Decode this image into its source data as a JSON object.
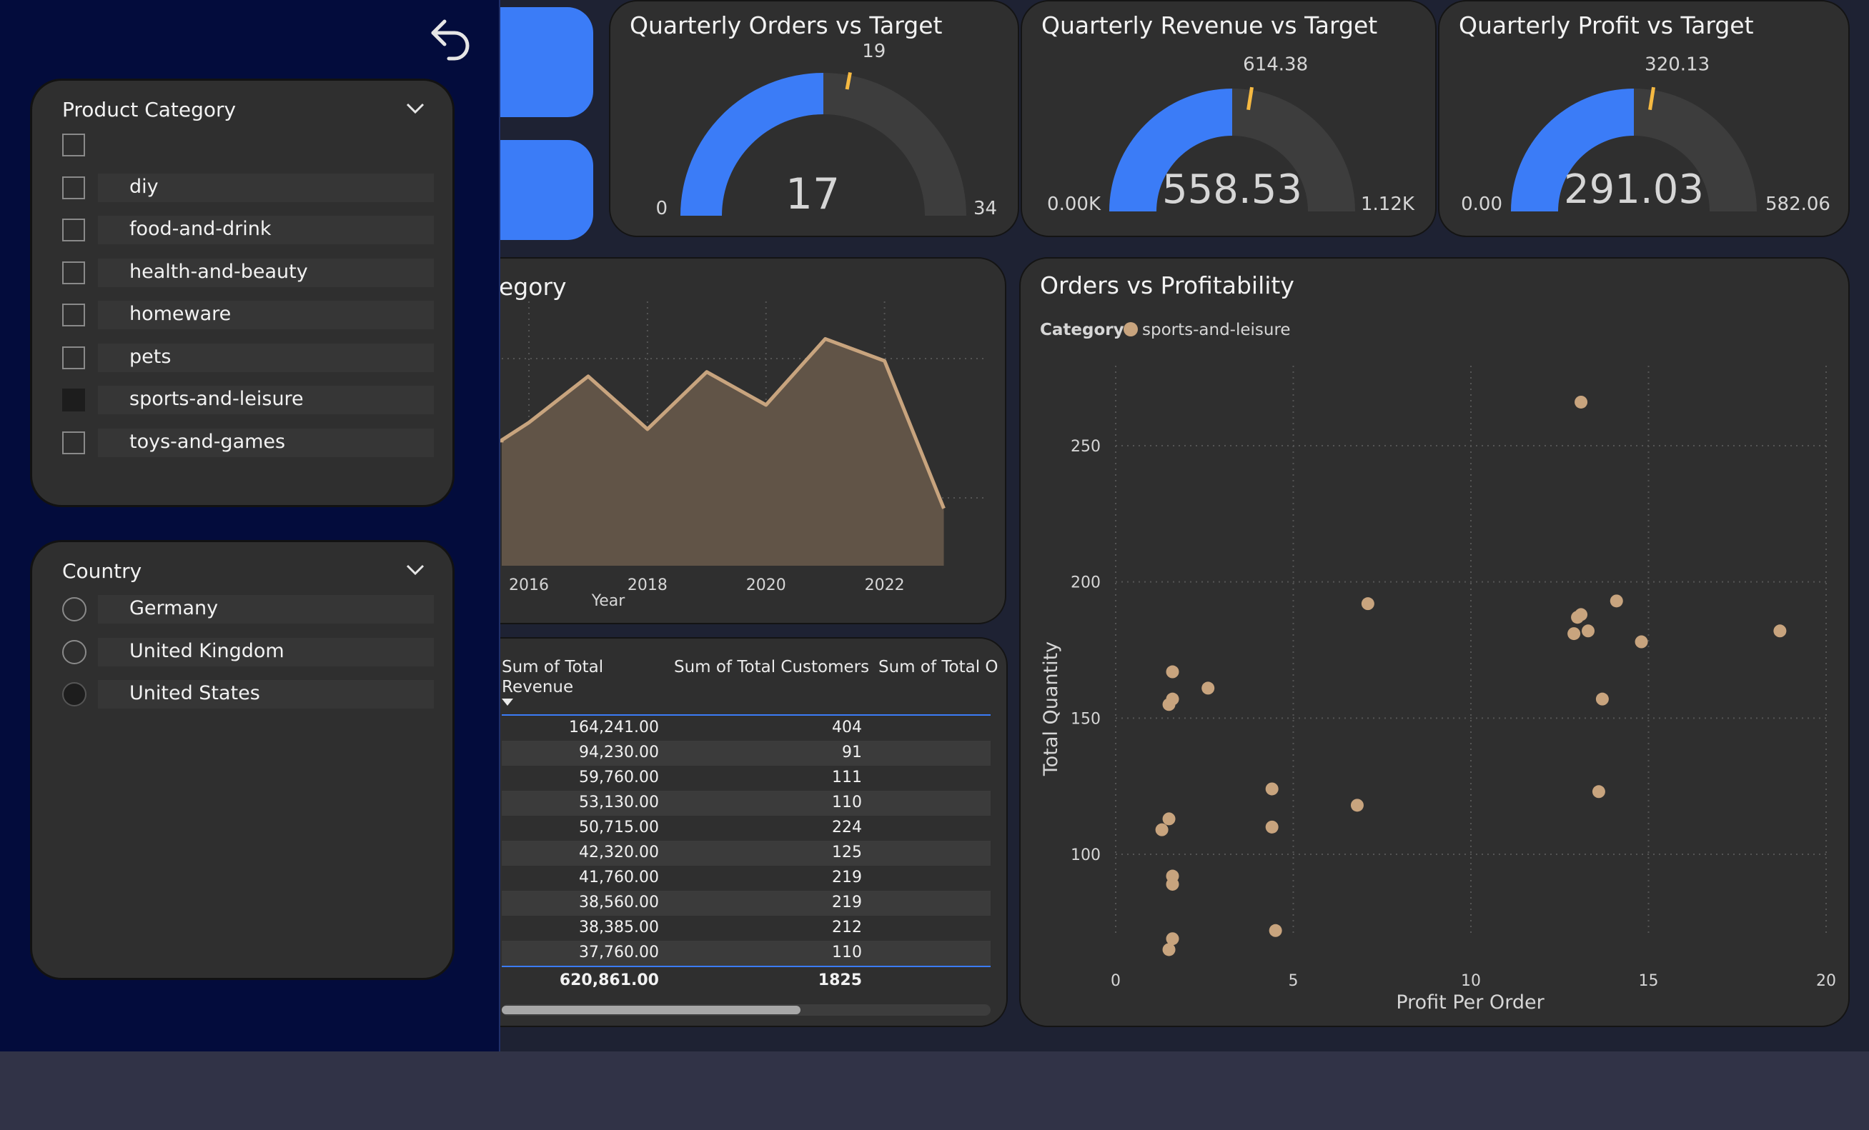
{
  "sidebar": {
    "back_icon": "undo-arrow-icon",
    "product_category": {
      "title": "Product Category",
      "items": [
        {
          "label": "",
          "selected": false
        },
        {
          "label": "diy",
          "selected": false
        },
        {
          "label": "food-and-drink",
          "selected": false
        },
        {
          "label": "health-and-beauty",
          "selected": false
        },
        {
          "label": "homeware",
          "selected": false
        },
        {
          "label": "pets",
          "selected": false
        },
        {
          "label": "sports-and-leisure",
          "selected": true
        },
        {
          "label": "toys-and-games",
          "selected": false
        }
      ]
    },
    "country": {
      "title": "Country",
      "items": [
        {
          "label": "Germany",
          "selected": false
        },
        {
          "label": "United Kingdom",
          "selected": false
        },
        {
          "label": "United States",
          "selected": true
        }
      ]
    }
  },
  "gauges": [
    {
      "title": "Quarterly Orders vs Target",
      "value_label": "17",
      "target_label": "19",
      "min_label": "0",
      "max_label": "34",
      "value": 17,
      "target": 19,
      "min": 0,
      "max": 34
    },
    {
      "title": "Quarterly Revenue vs Target",
      "value_label": "558.53",
      "target_label": "614.38",
      "min_label": "0.00K",
      "max_label": "1.12K",
      "value": 558.53,
      "target": 614.38,
      "min": 0,
      "max": 1117.06
    },
    {
      "title": "Quarterly Profit vs Target",
      "value_label": "291.03",
      "target_label": "320.13",
      "min_label": "0.00",
      "max_label": "582.06",
      "value": 291.03,
      "target": 320.13,
      "min": 0,
      "max": 582.06
    }
  ],
  "area_chart": {
    "title_visible": "egory",
    "xlabel": "Year",
    "chart_data": {
      "type": "area",
      "x": [
        2014.5,
        2015,
        2016,
        2017,
        2018,
        2019,
        2020,
        2021,
        2022,
        2023
      ],
      "values": [
        560,
        570,
        650,
        860,
        620,
        880,
        730,
        1030,
        930,
        260
      ],
      "xticks": [
        "2016",
        "2018",
        "2020",
        "2022"
      ],
      "xtick_values": [
        2016,
        2018,
        2020,
        2022
      ],
      "xlim": [
        2015.3,
        2023.5
      ],
      "ylim": [
        0,
        1200
      ],
      "grid": true,
      "color": "#c8a47e"
    }
  },
  "table": {
    "headers": [
      "Sum of Total Revenue",
      "Sum of Total Customers",
      "Sum of Total O"
    ],
    "sort_icon": "sort-descending-icon",
    "rows": [
      {
        "revenue": "164,241.00",
        "customers": "404"
      },
      {
        "revenue": "94,230.00",
        "customers": "91"
      },
      {
        "revenue": "59,760.00",
        "customers": "111"
      },
      {
        "revenue": "53,130.00",
        "customers": "110"
      },
      {
        "revenue": "50,715.00",
        "customers": "224"
      },
      {
        "revenue": "42,320.00",
        "customers": "125"
      },
      {
        "revenue": "41,760.00",
        "customers": "219"
      },
      {
        "revenue": "38,560.00",
        "customers": "219"
      },
      {
        "revenue": "38,385.00",
        "customers": "212"
      },
      {
        "revenue": "37,760.00",
        "customers": "110"
      }
    ],
    "total": {
      "revenue": "620,861.00",
      "customers": "1825"
    }
  },
  "scatter": {
    "title": "Orders vs Profitability",
    "legend_title": "Category",
    "legend_item": "sports-and-leisure",
    "chart_data": {
      "type": "scatter",
      "xlabel": "Profit Per Order",
      "ylabel": "Total Quantity",
      "xlim": [
        0,
        20
      ],
      "ylim": [
        60,
        280
      ],
      "xticks": [
        0,
        5,
        10,
        15,
        20
      ],
      "yticks": [
        100,
        150,
        200,
        250
      ],
      "grid": true,
      "color": "#c8a47e",
      "series": [
        {
          "name": "sports-and-leisure",
          "points": [
            [
              13.1,
              266
            ],
            [
              7.1,
              192
            ],
            [
              14.1,
              193
            ],
            [
              18.7,
              182
            ],
            [
              13.1,
              188
            ],
            [
              13.0,
              187
            ],
            [
              13.3,
              182
            ],
            [
              12.9,
              181
            ],
            [
              14.8,
              178
            ],
            [
              1.6,
              167
            ],
            [
              2.6,
              161
            ],
            [
              1.6,
              157
            ],
            [
              1.5,
              155
            ],
            [
              13.7,
              157
            ],
            [
              4.4,
              124
            ],
            [
              6.8,
              118
            ],
            [
              13.6,
              123
            ],
            [
              1.5,
              113
            ],
            [
              4.4,
              110
            ],
            [
              1.3,
              109
            ],
            [
              1.6,
              92
            ],
            [
              1.6,
              89
            ],
            [
              4.5,
              72
            ],
            [
              1.6,
              69
            ],
            [
              1.5,
              65
            ]
          ]
        }
      ]
    }
  }
}
